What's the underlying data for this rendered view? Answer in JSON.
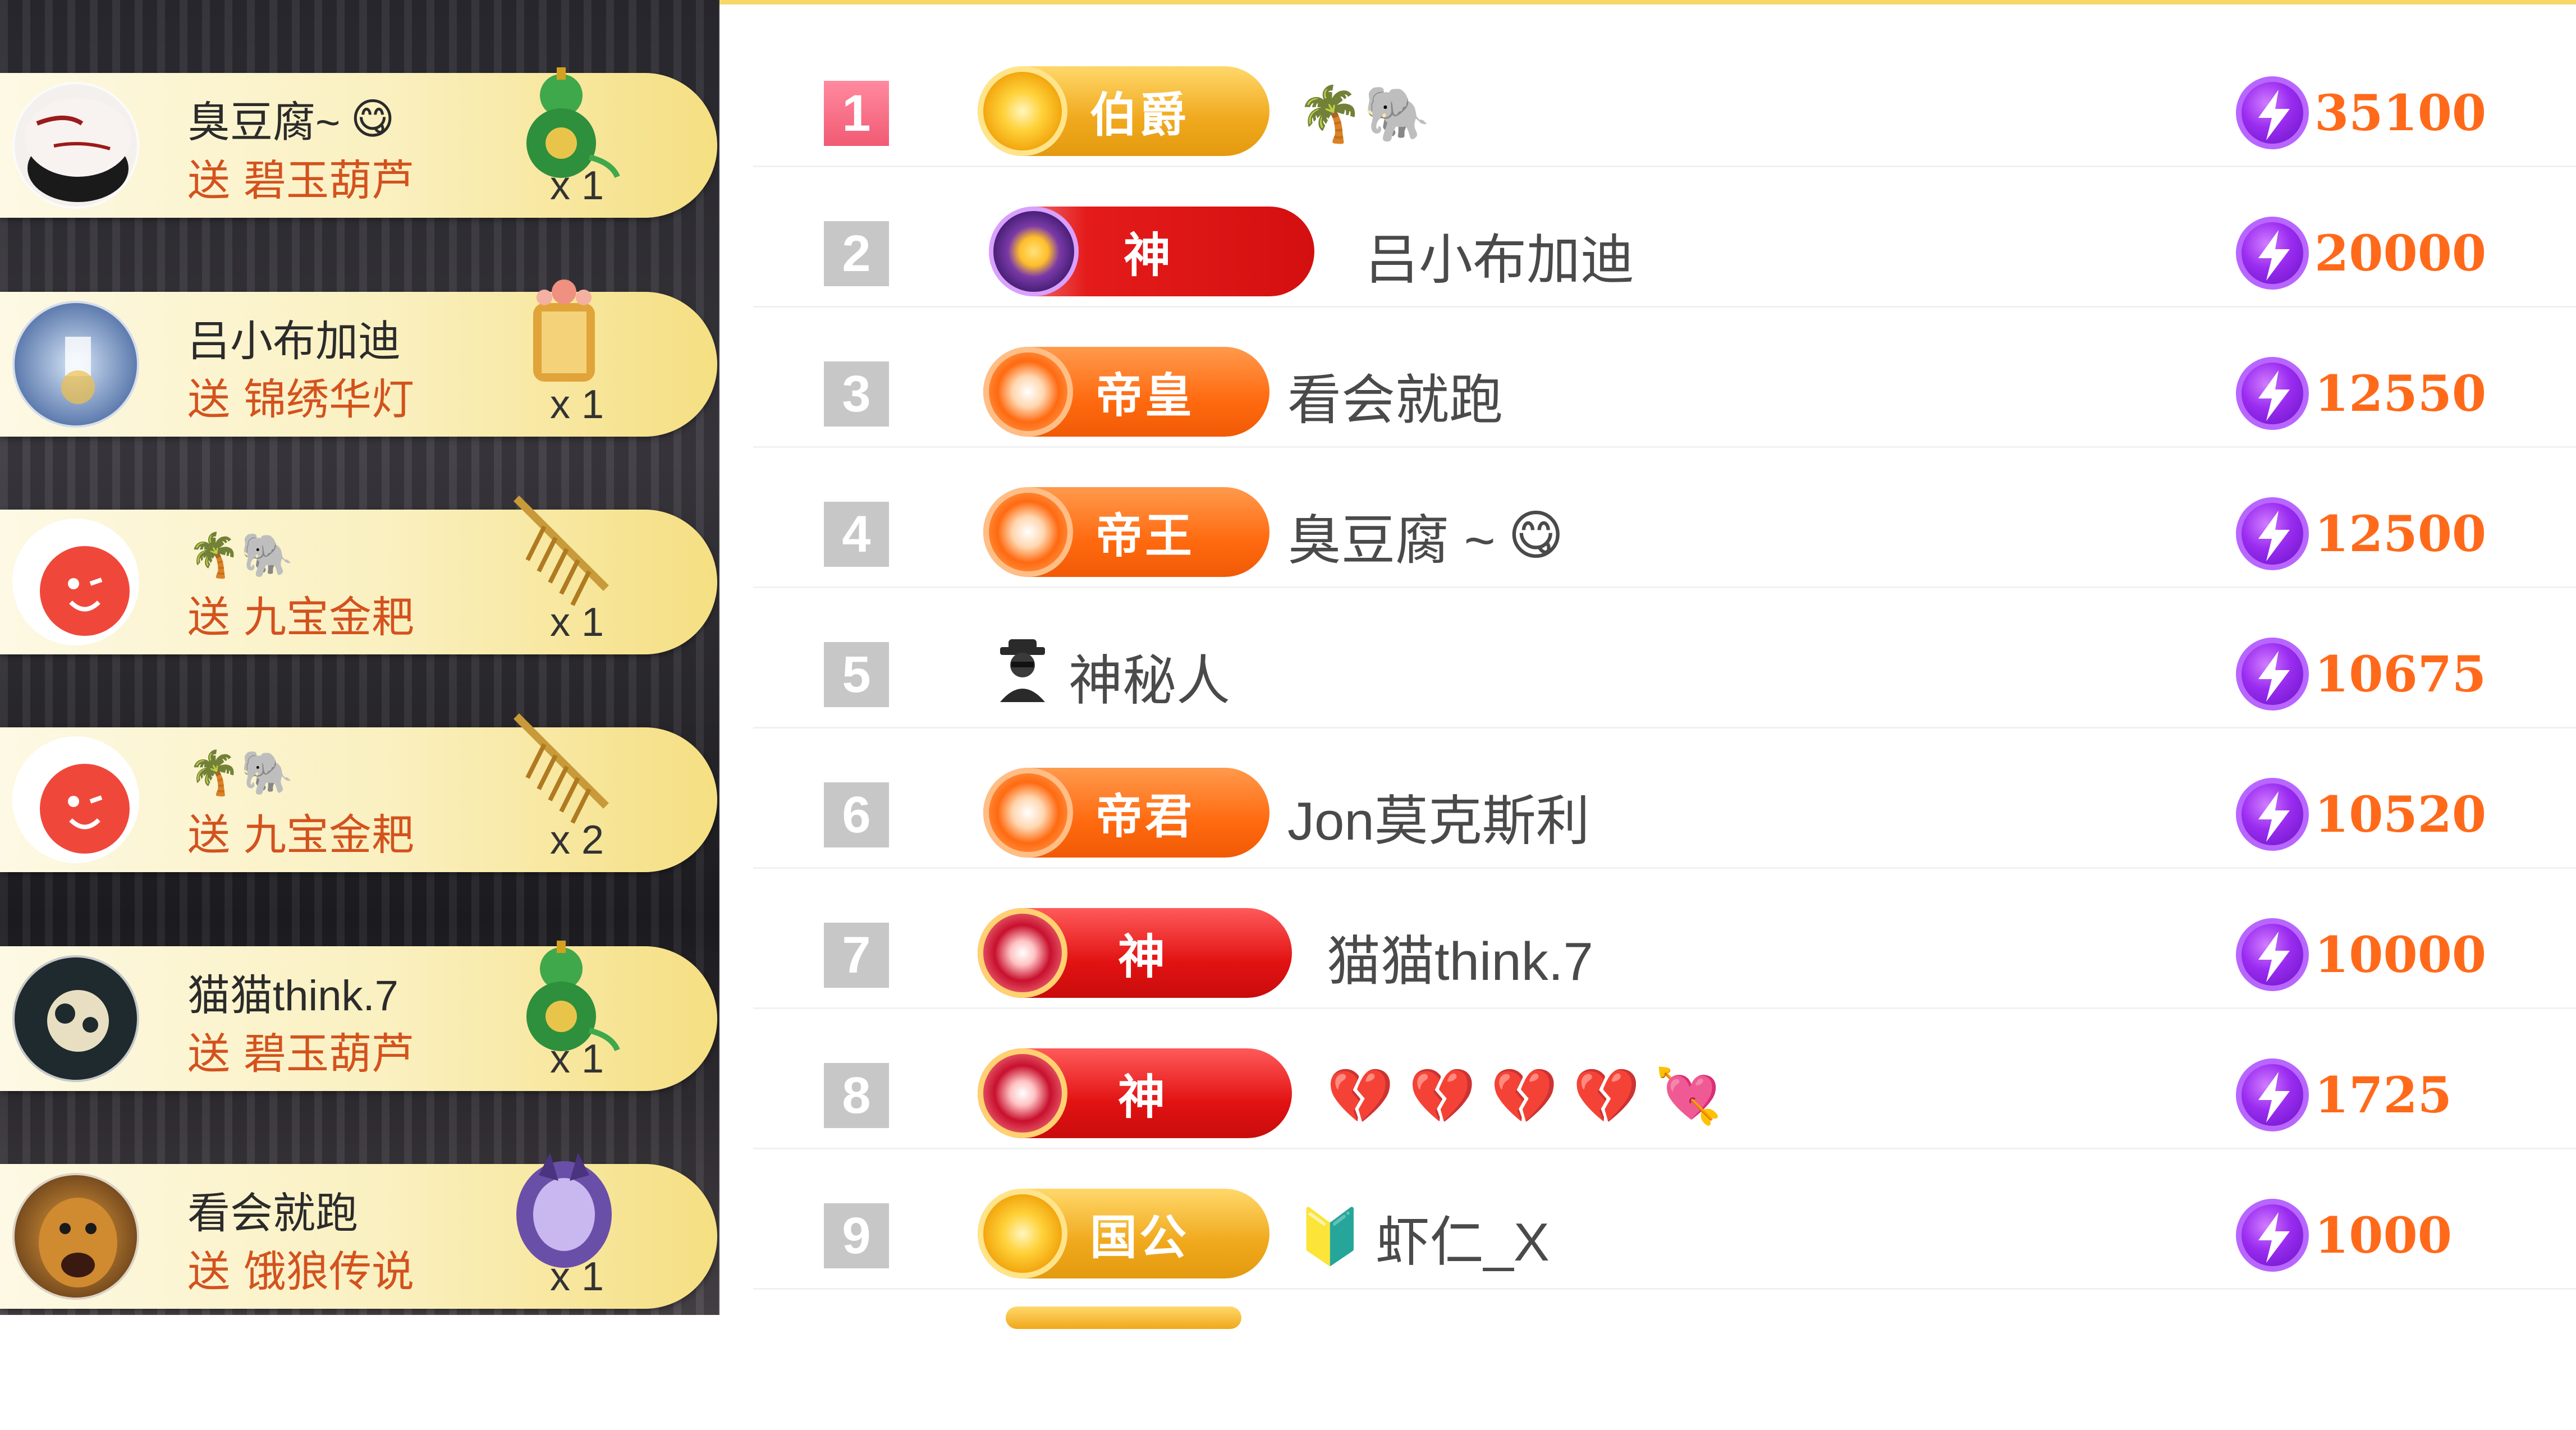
{
  "gift_feed": [
    {
      "user": "臭豆腐~",
      "user_emoji": "😋",
      "send_label": "送",
      "gift": "碧玉葫芦",
      "qty": "x 1",
      "gift_icon": "jade-gourd-icon"
    },
    {
      "user": "吕小布加迪",
      "user_emoji": "",
      "send_label": "送",
      "gift": "锦绣华灯",
      "qty": "x 1",
      "gift_icon": "lantern-icon"
    },
    {
      "user": "",
      "user_emoji": "🌴🐘",
      "send_label": "送",
      "gift": "九宝金耙",
      "qty": "x 1",
      "gift_icon": "golden-rake-icon"
    },
    {
      "user": "",
      "user_emoji": "🌴🐘",
      "send_label": "送",
      "gift": "九宝金耙",
      "qty": "x 2",
      "gift_icon": "golden-rake-icon"
    },
    {
      "user": "猫猫think.7",
      "user_emoji": "",
      "send_label": "送",
      "gift": "碧玉葫芦",
      "qty": "x 1",
      "gift_icon": "jade-gourd-icon"
    },
    {
      "user": "看会就跑",
      "user_emoji": "",
      "send_label": "送",
      "gift": "饿狼传说",
      "qty": "x 1",
      "gift_icon": "wolf-legend-icon"
    }
  ],
  "ranking": [
    {
      "rank": "1",
      "badge": "伯爵",
      "badge_style": "gold",
      "name": "",
      "name_emoji": "🌴🐘",
      "score": "35100"
    },
    {
      "rank": "2",
      "badge": "神",
      "badge_style": "god",
      "name": "吕小布加迪",
      "name_emoji": "",
      "score": "20000"
    },
    {
      "rank": "3",
      "badge": "帝皇",
      "badge_style": "orange",
      "name": "看会就跑",
      "name_emoji": "",
      "score": "12550"
    },
    {
      "rank": "4",
      "badge": "帝王",
      "badge_style": "orange",
      "name": "臭豆腐 ~",
      "name_emoji": "😋",
      "score": "12500"
    },
    {
      "rank": "5",
      "badge": "",
      "badge_style": "mystery",
      "name": "神秘人",
      "name_emoji": "",
      "score": "10675"
    },
    {
      "rank": "6",
      "badge": "帝君",
      "badge_style": "orange",
      "name": "Jon莫克斯利",
      "name_emoji": "",
      "score": "10520"
    },
    {
      "rank": "7",
      "badge": "神",
      "badge_style": "red",
      "name": "猫猫think.7",
      "name_emoji": "",
      "score": "10000"
    },
    {
      "rank": "8",
      "badge": "神",
      "badge_style": "red",
      "name": "",
      "name_emoji": "💔 💔 💔 💔 💘",
      "score": "1725"
    },
    {
      "rank": "9",
      "badge": "国公",
      "badge_style": "gold",
      "name": "虾仁_X",
      "name_emoji": "🔰",
      "score": "1000"
    }
  ],
  "colors": {
    "accent_orange": "#ff6a1a",
    "coin_purple": "#9a2cf0",
    "rank_first": "#f15a73",
    "rank_other": "#c7c7c7",
    "send_text": "#d3521e"
  }
}
